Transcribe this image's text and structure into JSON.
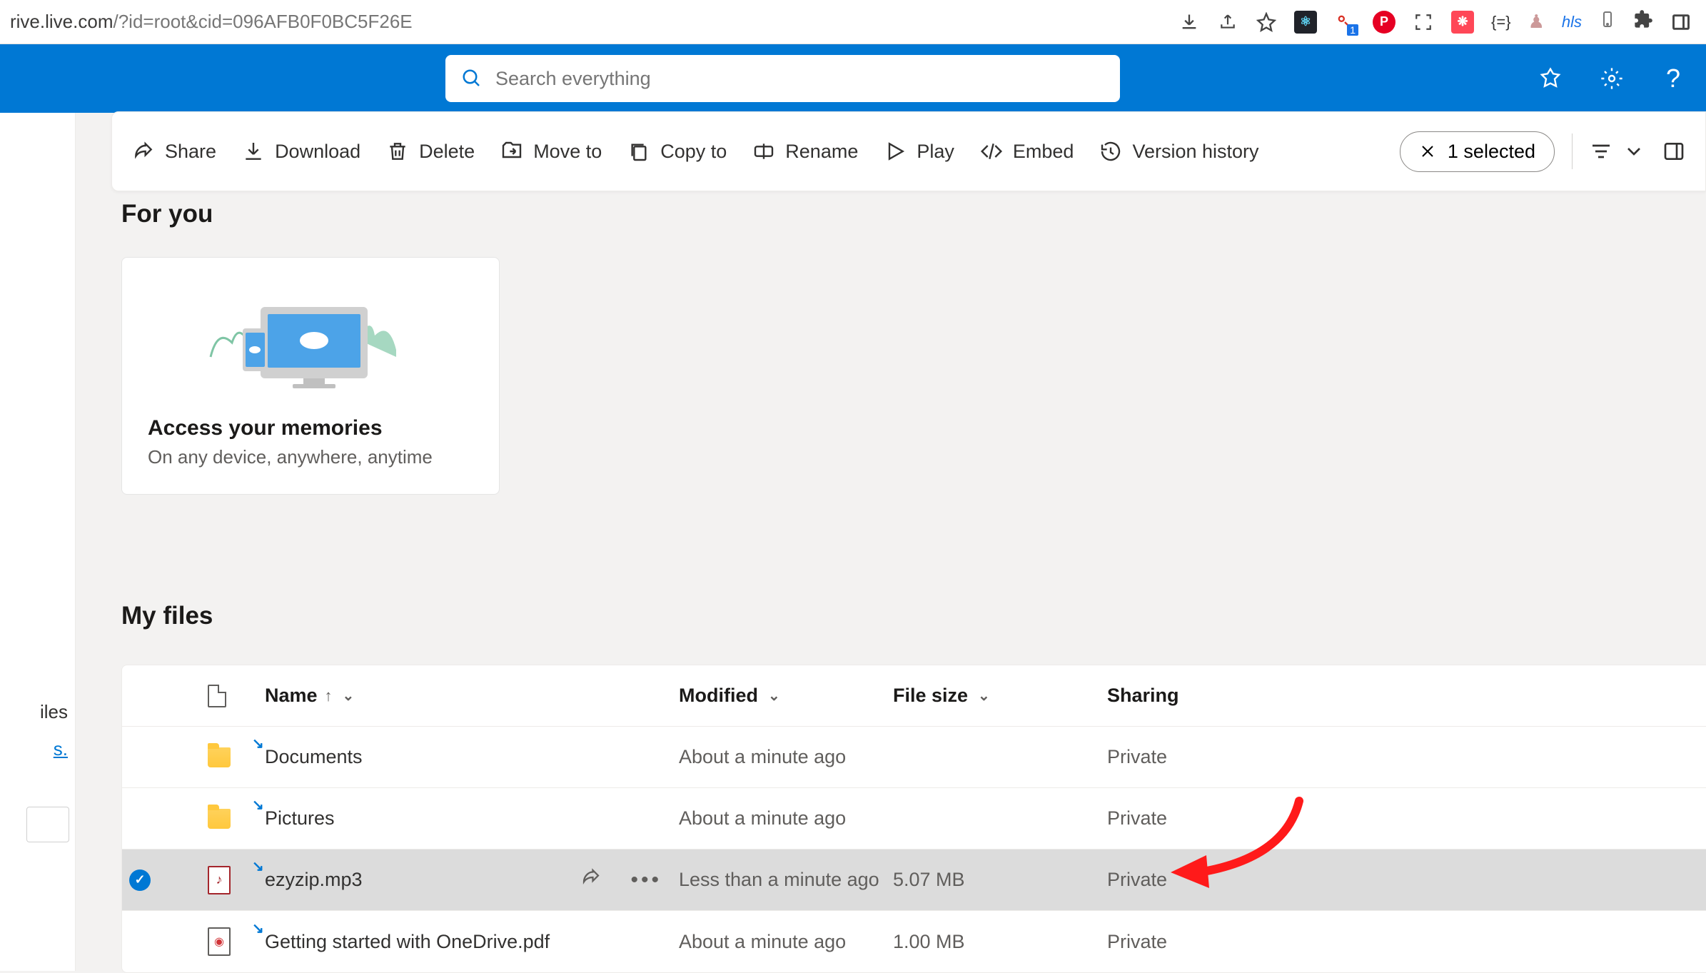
{
  "browser": {
    "url_host": "rive.live.com",
    "url_path": "/?id=root&cid=096AFB0F0BC5F26E"
  },
  "header": {
    "search_placeholder": "Search everything"
  },
  "toolbar": {
    "share": "Share",
    "download": "Download",
    "delete": "Delete",
    "move_to": "Move to",
    "copy_to": "Copy to",
    "rename": "Rename",
    "play": "Play",
    "embed": "Embed",
    "version_history": "Version history",
    "selected_label": "1 selected"
  },
  "sidebar": {
    "item_iles": "iles",
    "item_link": "s."
  },
  "for_you": {
    "title": "For you",
    "card_title": "Access your memories",
    "card_subtitle": "On any device, anywhere, anytime"
  },
  "my_files": {
    "title": "My files",
    "columns": {
      "name": "Name",
      "modified": "Modified",
      "file_size": "File size",
      "sharing": "Sharing"
    },
    "rows": [
      {
        "name": "Documents",
        "type": "folder",
        "modified": "About a minute ago",
        "size": "",
        "sharing": "Private",
        "selected": false
      },
      {
        "name": "Pictures",
        "type": "folder",
        "modified": "About a minute ago",
        "size": "",
        "sharing": "Private",
        "selected": false
      },
      {
        "name": "ezyzip.mp3",
        "type": "audio",
        "modified": "Less than a minute ago",
        "size": "5.07 MB",
        "sharing": "Private",
        "selected": true
      },
      {
        "name": "Getting started with OneDrive.pdf",
        "type": "pdf",
        "modified": "About a minute ago",
        "size": "1.00 MB",
        "sharing": "Private",
        "selected": false
      }
    ]
  }
}
